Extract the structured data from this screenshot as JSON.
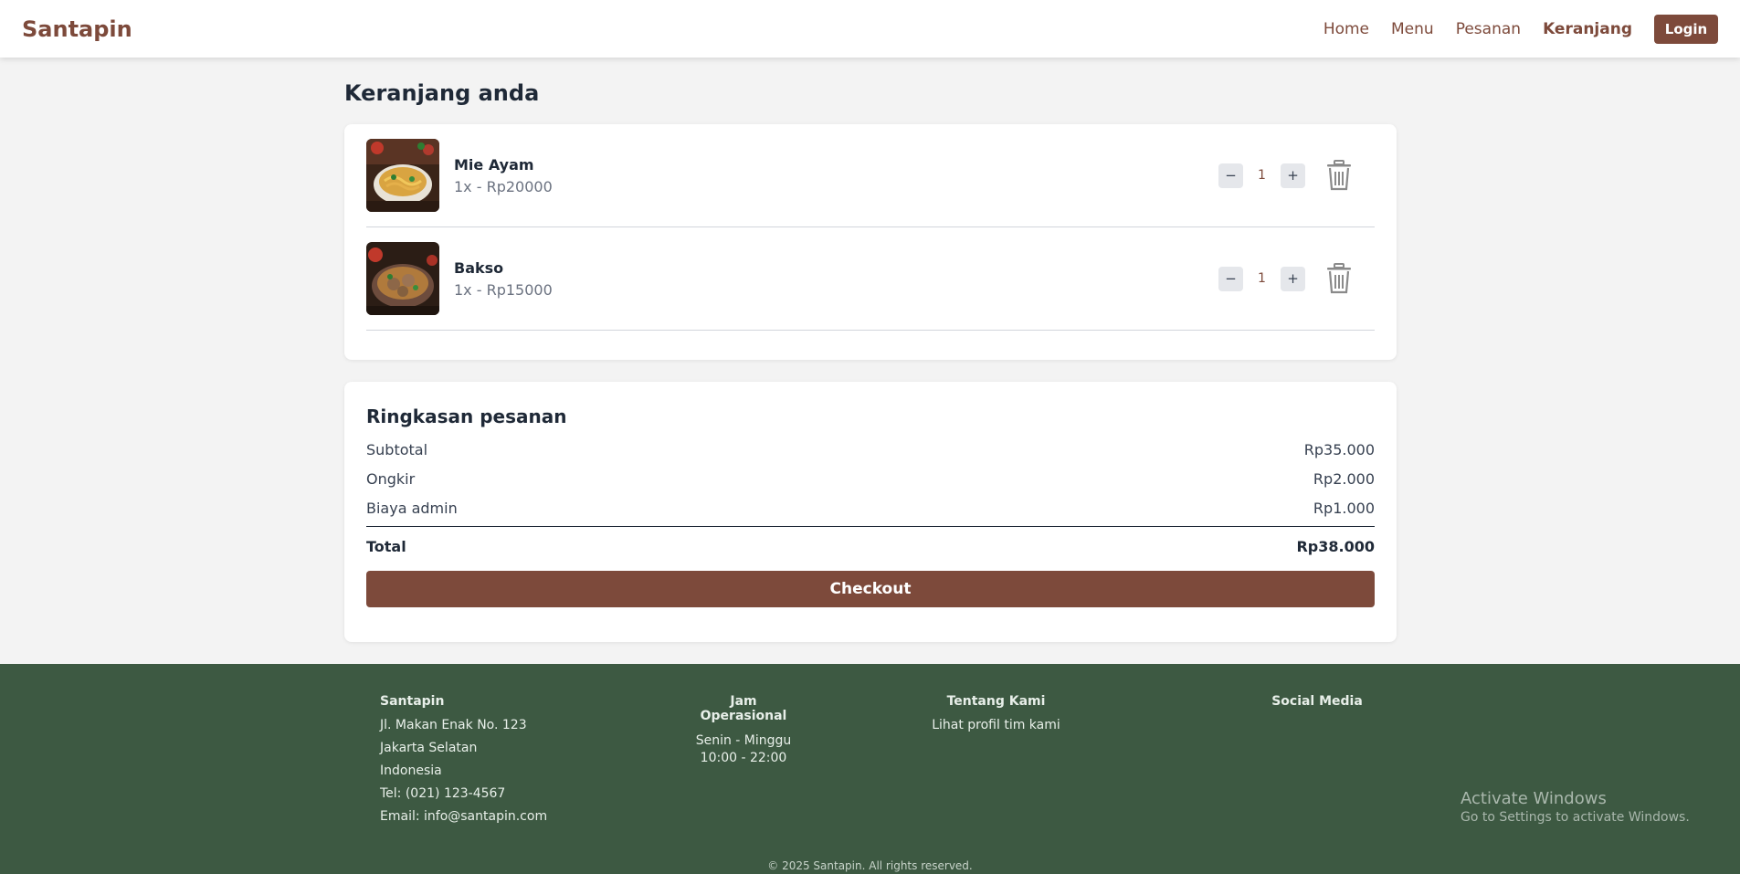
{
  "nav": {
    "brand": "Santapin",
    "links": [
      "Home",
      "Menu",
      "Pesanan",
      "Keranjang"
    ],
    "active": "Keranjang",
    "login_label": "Login"
  },
  "cart": {
    "title": "Keranjang anda",
    "items": [
      {
        "name": "Mie Ayam",
        "detail": "1x - Rp20000",
        "qty": "1",
        "image": "mie-ayam-photo"
      },
      {
        "name": "Bakso",
        "detail": "1x - Rp15000",
        "qty": "1",
        "image": "bakso-photo"
      }
    ],
    "minus_label": "−",
    "plus_label": "+"
  },
  "summary": {
    "title": "Ringkasan pesanan",
    "rows": [
      {
        "label": "Subtotal",
        "value": "Rp35.000"
      },
      {
        "label": "Ongkir",
        "value": "Rp2.000"
      },
      {
        "label": "Biaya admin",
        "value": "Rp1.000"
      }
    ],
    "total_label": "Total",
    "total_value": "Rp38.000",
    "checkout_label": "Checkout"
  },
  "footer": {
    "col1": {
      "title": "Santapin",
      "lines": [
        "Jl. Makan Enak No. 123",
        "Jakarta Selatan",
        "Indonesia",
        "Tel: (021) 123-4567",
        "Email: info@santapin.com"
      ]
    },
    "col2": {
      "title": "Jam Operasional",
      "lines": [
        "Senin - Minggu",
        "10:00 - 22:00"
      ]
    },
    "col3": {
      "title": "Tentang Kami",
      "link": "Lihat profil tim kami"
    },
    "col4": {
      "title": "Social Media"
    },
    "copyright": "© 2025 Santapin. All rights reserved."
  },
  "watermark": {
    "title": "Activate Windows",
    "subtitle": "Go to Settings to activate Windows."
  },
  "colors": {
    "brand": "#7d4a3b",
    "footer_bg": "#3d5942",
    "page_bg": "#f3f3f3"
  }
}
